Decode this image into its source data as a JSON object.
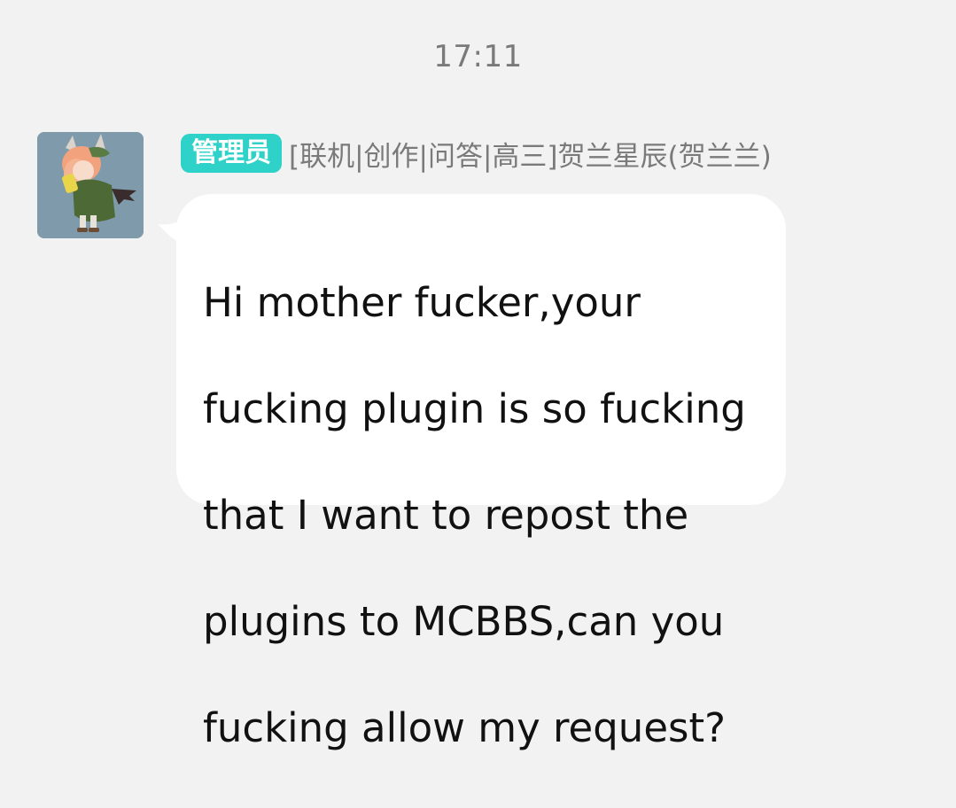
{
  "chat": {
    "timestamp": "17:11",
    "message": {
      "role_badge": "管理员",
      "sender_name": "[联机|创作|问答|高三]贺兰星辰(贺兰兰)",
      "text_lines": [
        "Hi mother fucker,your",
        "fucking plugin is so fucking",
        "that I want to repost the",
        "plugins to MCBBS,can you",
        "fucking allow my request?"
      ],
      "avatar_icon": "anime-avatar-icon"
    }
  },
  "colors": {
    "background": "#f2f2f2",
    "bubble": "#ffffff",
    "badge": "#2fd2c8",
    "meta_text": "#7a7a7a",
    "message_text": "#111111"
  }
}
